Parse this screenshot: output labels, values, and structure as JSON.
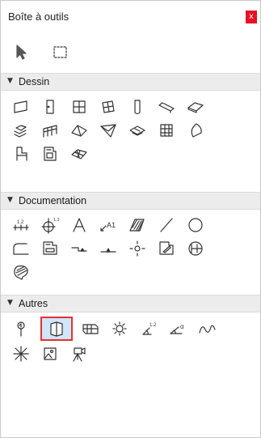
{
  "window": {
    "title": "Boîte à outils",
    "close_glyph": "x",
    "close_color": "#e81123"
  },
  "top_tools": [
    {
      "name": "arrow-pointer-icon"
    },
    {
      "name": "marquee-select-icon"
    }
  ],
  "sections": [
    {
      "label": "Dessin",
      "expanded": true,
      "tools": [
        "wall-icon",
        "door-icon",
        "window-icon",
        "skylight-icon",
        "column-icon",
        "beam-icon",
        "slab-icon",
        "stair-icon",
        "railing-icon",
        "roof-icon",
        "shell-icon",
        "morph-icon",
        "curtain-wall-icon",
        "zone-icon",
        "object-icon",
        "lamp-object-icon",
        "mesh-icon"
      ]
    },
    {
      "label": "Documentation",
      "expanded": true,
      "tools": [
        "dimension-icon",
        "radial-dimension-icon",
        "text-icon",
        "label-icon",
        "fill-icon",
        "line-icon",
        "circle-icon",
        "polyline-icon",
        "drawing-icon",
        "level-dimension-icon",
        "elevation-marker-icon",
        "hotspot-icon",
        "figure-icon",
        "change-marker-icon",
        "fill-pattern-icon"
      ]
    },
    {
      "label": "Autres",
      "expanded": true,
      "tools": [
        "grid-element-icon",
        "section-tool-icon",
        "worksheet-icon",
        "lamp-icon",
        "angle-dimension-icon",
        "angle-dimension-alpha-icon",
        "spline-icon",
        "radial-grid-icon",
        "image-icon",
        "camera-icon"
      ]
    }
  ],
  "selected_tool": "section-tool-icon",
  "colors": {
    "selection_border": "#e8302e",
    "selection_fill": "#cfe6fb",
    "section_header_bg": "#ececec"
  },
  "small_labels": {
    "dimension": "1.2",
    "radial": "1.2",
    "label_text": "A1",
    "angle": "1.2",
    "alpha": "α"
  }
}
